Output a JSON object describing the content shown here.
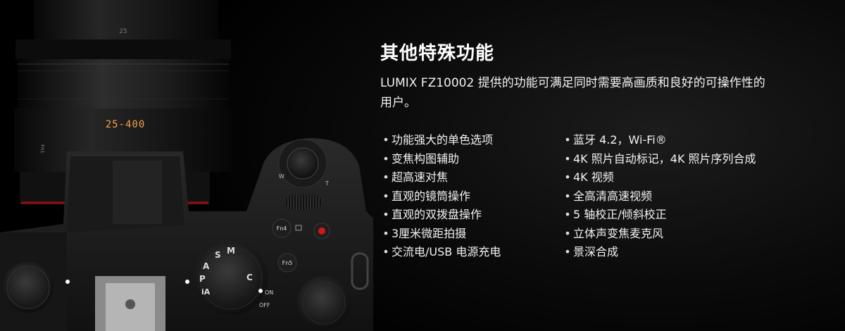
{
  "heading": "其他特殊功能",
  "description": "LUMIX FZ10002 提供的功能可满足同时需要高画质和良好的可操作性的用户。",
  "features_left": [
    "功能强大的单色选项",
    "变焦构图辅助",
    "超高速对焦",
    "直观的镜筒操作",
    "直观的双拨盘操作",
    "3厘米微距拍摄",
    "交流电/USB 电源充电"
  ],
  "features_right": [
    "蓝牙 4.2，Wi-Fi®",
    "4K 照片自动标记，4K 照片序列合成",
    "4K 视频",
    "全高清高速视频",
    "5 轴校正/倾斜校正",
    "立体声变焦麦克风",
    "景深合成"
  ],
  "bullet_symbol": "•",
  "camera": {
    "lens_zoom_range": "25-400",
    "lens_scale_mark": "25",
    "lens_fn_label": "Fn1",
    "fn4_label": "Fn4",
    "fn5_label": "Fn5",
    "mode_dial_letters": [
      "S",
      "M",
      "C",
      "A",
      "P",
      "iA"
    ],
    "power_on_label": "ON",
    "power_off_label": "OFF",
    "zoom_w_label": "W",
    "zoom_t_label": "T",
    "lens_color": "#f5a04a",
    "record_color": "#d01818"
  },
  "colors": {
    "background": "#000000",
    "text": "#ffffff"
  }
}
